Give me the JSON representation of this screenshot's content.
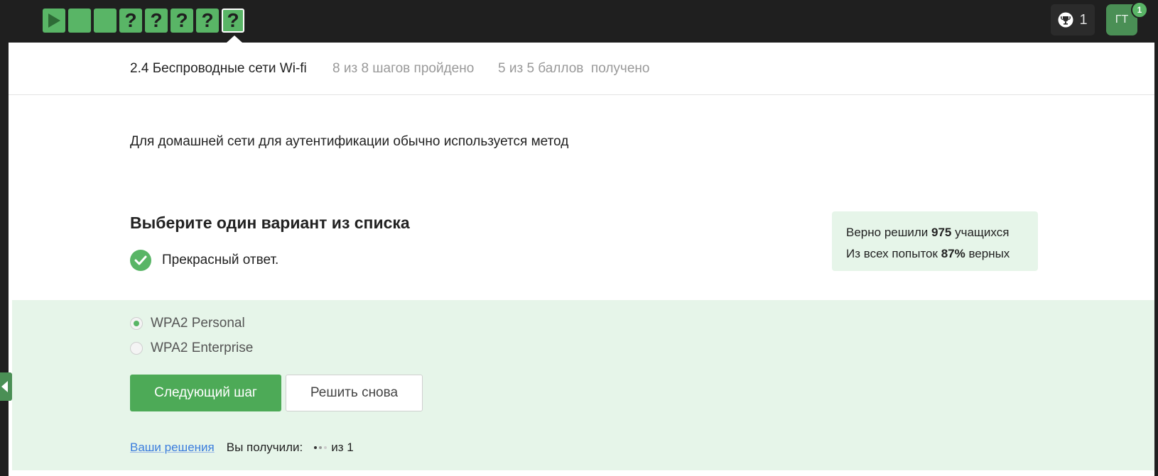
{
  "steps": {
    "items": [
      {
        "type": "play",
        "label": "▶",
        "icon": "play-icon"
      },
      {
        "type": "done",
        "label": ""
      },
      {
        "type": "done",
        "label": ""
      },
      {
        "type": "quiz",
        "label": "?"
      },
      {
        "type": "quiz",
        "label": "?"
      },
      {
        "type": "quiz",
        "label": "?"
      },
      {
        "type": "quiz",
        "label": "?"
      },
      {
        "type": "quiz",
        "label": "?",
        "current": true
      }
    ]
  },
  "header": {
    "trophy_count": "1",
    "avatar_initials": "ГТ",
    "notification_count": "1"
  },
  "lesson": {
    "title": "2.4 Беспроводные сети Wi-fi",
    "progress": "8 из 8 шагов пройдено",
    "score": "5 из 5 баллов  получено"
  },
  "question": {
    "text": "Для домашней сети для аутентификации обычно используется метод",
    "prompt": "Выберите один вариант из списка",
    "result": "Прекрасный ответ."
  },
  "stats": {
    "solved_prefix": "Верно решили",
    "solved_count": "975",
    "solved_suffix": "учащихся",
    "attempts_prefix": "Из всех попыток",
    "attempts_percent": "87%",
    "attempts_suffix": "верных"
  },
  "options": [
    {
      "label": "WPA2 Personal",
      "checked": true
    },
    {
      "label": "WPA2 Enterprise",
      "checked": false
    }
  ],
  "buttons": {
    "next": "Следующий шаг",
    "retry": "Решить снова"
  },
  "solutions": {
    "link": "Ваши решения",
    "received_label": "Вы получили:",
    "of_total": "из 1"
  },
  "colors": {
    "accent": "#59b566",
    "answer_bg": "#e6f5e9",
    "topbar_bg": "#1f1f1f"
  }
}
